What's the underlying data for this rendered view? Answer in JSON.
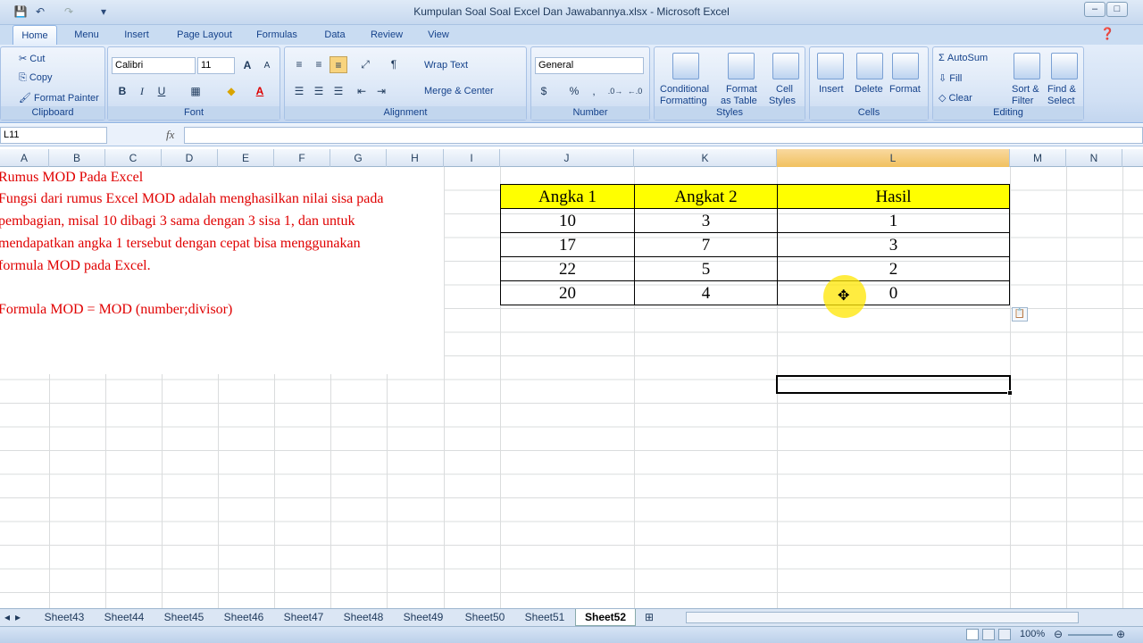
{
  "window": {
    "title": "Kumpulan Soal Soal Excel Dan Jawabannya.xlsx - Microsoft Excel"
  },
  "tabs": [
    "Home",
    "Menu",
    "Insert",
    "Page Layout",
    "Formulas",
    "Data",
    "Review",
    "View"
  ],
  "active_tab": "Home",
  "ribbon": {
    "clipboard": {
      "label": "Clipboard",
      "cut": "Cut",
      "copy": "Copy",
      "format_painter": "Format Painter"
    },
    "font": {
      "label": "Font",
      "name": "Calibri",
      "size": "11",
      "bold": "B",
      "italic": "I",
      "underline": "U"
    },
    "alignment": {
      "label": "Alignment",
      "wrap_text": "Wrap Text",
      "merge_center": "Merge & Center"
    },
    "number": {
      "label": "Number",
      "format": "General",
      "percent": "%",
      "comma": ","
    },
    "styles": {
      "label": "Styles",
      "conditional": "Conditional",
      "conditional2": "Formatting",
      "format_table": "Format",
      "format_table2": "as Table",
      "cell_styles": "Cell",
      "cell_styles2": "Styles"
    },
    "cells": {
      "label": "Cells",
      "insert": "Insert",
      "delete": "Delete",
      "format": "Format"
    },
    "editing": {
      "label": "Editing",
      "autosum": "AutoSum",
      "fill": "Fill",
      "clear": "Clear",
      "sort": "Sort &",
      "sort2": "Filter",
      "find": "Find &",
      "find2": "Select"
    }
  },
  "formula_bar": {
    "name_box": "L11",
    "fx": "fx",
    "value": ""
  },
  "columns": [
    "A",
    "B",
    "C",
    "D",
    "E",
    "F",
    "G",
    "H",
    "I",
    "J",
    "K",
    "L",
    "M",
    "N"
  ],
  "selected_column": "L",
  "notes": [
    "Rumus MOD Pada Excel",
    "Fungsi dari rumus Excel MOD adalah menghasilkan nilai sisa pada",
    "pembagian, misal 10 dibagi 3 sama dengan 3 sisa 1, dan untuk",
    "mendapatkan angka 1 tersebut dengan cepat bisa menggunakan",
    "formula MOD pada Excel.",
    "Formula MOD = MOD (number;divisor)"
  ],
  "table": {
    "headers": [
      "Angka 1",
      "Angkat 2",
      "Hasil"
    ],
    "rows": [
      [
        "10",
        "3",
        "1"
      ],
      [
        "17",
        "7",
        "3"
      ],
      [
        "22",
        "5",
        "2"
      ],
      [
        "20",
        "4",
        "0"
      ]
    ]
  },
  "sheets": [
    "Sheet43",
    "Sheet44",
    "Sheet45",
    "Sheet46",
    "Sheet47",
    "Sheet48",
    "Sheet49",
    "Sheet50",
    "Sheet51",
    "Sheet52"
  ],
  "active_sheet": "Sheet52",
  "status": {
    "zoom": "100%"
  }
}
